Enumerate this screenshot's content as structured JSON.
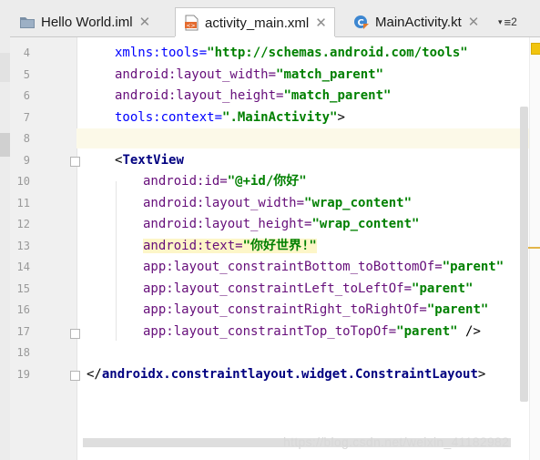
{
  "tabs": [
    {
      "label": "Hello World.iml",
      "icon": "module-file-icon",
      "active": false
    },
    {
      "label": "activity_main.xml",
      "icon": "xml-file-icon",
      "active": true
    },
    {
      "label": "MainActivity.kt",
      "icon": "kotlin-class-icon",
      "active": false
    }
  ],
  "tab_overflow": {
    "count": "2"
  },
  "editor": {
    "lines": [
      {
        "no": "4",
        "parts": [
          {
            "t": "xmlns:tools=",
            "c": "ns"
          },
          {
            "t": "\"http://schemas.android.com/tools\"",
            "c": "val"
          }
        ],
        "indent": 1
      },
      {
        "no": "5",
        "parts": [
          {
            "t": "android:layout_width=",
            "c": "attr"
          },
          {
            "t": "\"match_parent\"",
            "c": "val"
          }
        ],
        "indent": 1
      },
      {
        "no": "6",
        "parts": [
          {
            "t": "android:layout_height=",
            "c": "attr"
          },
          {
            "t": "\"match_parent\"",
            "c": "val"
          }
        ],
        "indent": 1
      },
      {
        "no": "7",
        "parts": [
          {
            "t": "tools:context=",
            "c": "ns"
          },
          {
            "t": "\".MainActivity\"",
            "c": "val"
          },
          {
            "t": ">",
            "c": "plain"
          }
        ],
        "indent": 1
      },
      {
        "no": "8",
        "parts": [],
        "indent": 0
      },
      {
        "no": "9",
        "parts": [
          {
            "t": "<",
            "c": "plain"
          },
          {
            "t": "TextView",
            "c": "tag"
          }
        ],
        "indent": 1
      },
      {
        "no": "10",
        "parts": [
          {
            "t": "android:id=",
            "c": "attr"
          },
          {
            "t": "\"@+id/你好\"",
            "c": "val"
          }
        ],
        "indent": 2
      },
      {
        "no": "11",
        "parts": [
          {
            "t": "android:layout_width=",
            "c": "attr"
          },
          {
            "t": "\"wrap_content\"",
            "c": "val"
          }
        ],
        "indent": 2
      },
      {
        "no": "12",
        "parts": [
          {
            "t": "android:layout_height=",
            "c": "attr"
          },
          {
            "t": "\"wrap_content\"",
            "c": "val"
          }
        ],
        "indent": 2
      },
      {
        "no": "13",
        "parts": [
          {
            "t": "android:text=",
            "c": "attr hl"
          },
          {
            "t": "\"你好世界!\"",
            "c": "val hl"
          }
        ],
        "indent": 2
      },
      {
        "no": "14",
        "parts": [
          {
            "t": "app:layout_constraintBottom_toBottomOf=",
            "c": "attr"
          },
          {
            "t": "\"parent\"",
            "c": "val"
          }
        ],
        "indent": 2
      },
      {
        "no": "15",
        "parts": [
          {
            "t": "app:layout_constraintLeft_toLeftOf=",
            "c": "attr"
          },
          {
            "t": "\"parent\"",
            "c": "val"
          }
        ],
        "indent": 2
      },
      {
        "no": "16",
        "parts": [
          {
            "t": "app:layout_constraintRight_toRightOf=",
            "c": "attr"
          },
          {
            "t": "\"parent\"",
            "c": "val"
          }
        ],
        "indent": 2
      },
      {
        "no": "17",
        "parts": [
          {
            "t": "app:layout_constraintTop_toTopOf=",
            "c": "attr"
          },
          {
            "t": "\"parent\"",
            "c": "val"
          },
          {
            "t": " />",
            "c": "plain"
          }
        ],
        "indent": 2
      },
      {
        "no": "18",
        "parts": [],
        "indent": 0
      },
      {
        "no": "19",
        "parts": [
          {
            "t": "</",
            "c": "plain"
          },
          {
            "t": "androidx.constraintlayout.widget.ConstraintLayout",
            "c": "tag"
          },
          {
            "t": ">",
            "c": "plain"
          }
        ],
        "indent": 0
      }
    ]
  },
  "watermark": "https://blog.csdn.net/weixin_41182982",
  "colors": {
    "attr": "#660e7a",
    "value": "#008000",
    "tag": "#000080",
    "current_line": "#fcf9e8"
  }
}
